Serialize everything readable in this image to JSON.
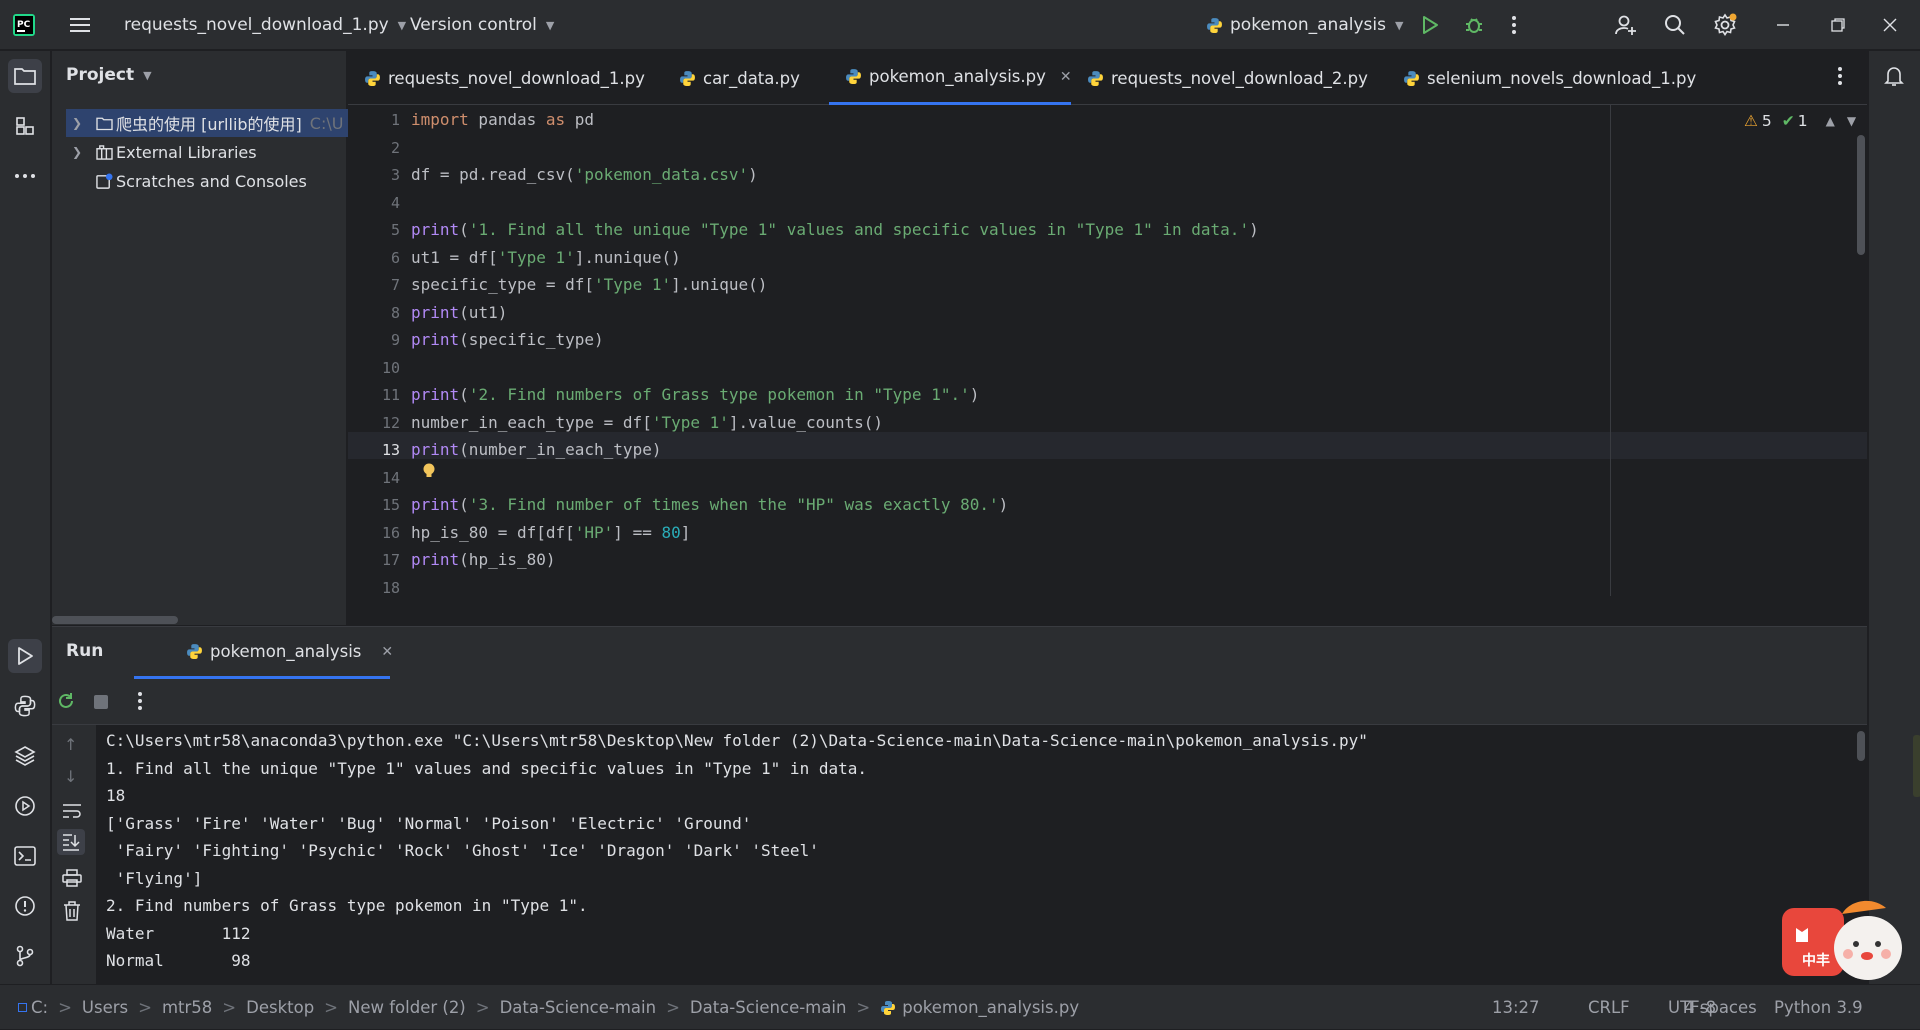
{
  "topbar": {
    "file_menu": "requests_novel_download_1.py",
    "vcs_menu": "Version control",
    "run_config": "pokemon_analysis"
  },
  "project": {
    "title": "Project",
    "items": [
      {
        "label": "爬虫的使用 [urllib的使用]",
        "path": "C:\\U"
      },
      {
        "label": "External Libraries"
      },
      {
        "label": "Scratches and Consoles"
      }
    ]
  },
  "tabs": [
    {
      "label": "requests_novel_download_1.py"
    },
    {
      "label": "car_data.py"
    },
    {
      "label": "pokemon_analysis.py",
      "active": true
    },
    {
      "label": "requests_novel_download_2.py"
    },
    {
      "label": "selenium_novels_download_1.py"
    }
  ],
  "inspections": {
    "warnings": "5",
    "ok": "1"
  },
  "code_lines": [
    [
      {
        "t": "import",
        "c": "kw"
      },
      {
        "t": " pandas "
      },
      {
        "t": "as",
        "c": "kw"
      },
      {
        "t": " pd"
      }
    ],
    [],
    [
      {
        "t": "df = pd.read_csv("
      },
      {
        "t": "'pokemon_data.csv'",
        "c": "st"
      },
      {
        "t": ")"
      }
    ],
    [],
    [
      {
        "t": "print",
        "c": "fn"
      },
      {
        "t": "("
      },
      {
        "t": "'1. Find all the unique \"Type 1\" values and specific values in \"Type 1\" in data.'",
        "c": "st"
      },
      {
        "t": ")"
      }
    ],
    [
      {
        "t": "ut1 = df["
      },
      {
        "t": "'Type 1'",
        "c": "st"
      },
      {
        "t": "].nunique()"
      }
    ],
    [
      {
        "t": "specific_type = df["
      },
      {
        "t": "'Type 1'",
        "c": "st"
      },
      {
        "t": "].unique()"
      }
    ],
    [
      {
        "t": "print",
        "c": "fn"
      },
      {
        "t": "(ut1)"
      }
    ],
    [
      {
        "t": "print",
        "c": "fn"
      },
      {
        "t": "(specific_type)"
      }
    ],
    [],
    [
      {
        "t": "print",
        "c": "fn"
      },
      {
        "t": "("
      },
      {
        "t": "'2. Find numbers of Grass type pokemon in \"Type 1\".'",
        "c": "st"
      },
      {
        "t": ")"
      }
    ],
    [
      {
        "t": "number_in_each_type = df["
      },
      {
        "t": "'Type 1'",
        "c": "st"
      },
      {
        "t": "].value_counts()"
      }
    ],
    [
      {
        "t": "print",
        "c": "fn"
      },
      {
        "t": "(number_in_each_type)"
      }
    ],
    [],
    [
      {
        "t": "print",
        "c": "fn"
      },
      {
        "t": "("
      },
      {
        "t": "'3. Find number of times when the \"HP\" was exactly 80.'",
        "c": "st"
      },
      {
        "t": ")"
      }
    ],
    [
      {
        "t": "hp_is_80 = df[df["
      },
      {
        "t": "'HP'",
        "c": "st"
      },
      {
        "t": "] == "
      },
      {
        "t": "80",
        "c": "nm"
      },
      {
        "t": "]"
      }
    ],
    [
      {
        "t": "print",
        "c": "fn"
      },
      {
        "t": "(hp_is_80)"
      }
    ],
    []
  ],
  "run": {
    "title": "Run",
    "tab": "pokemon_analysis",
    "output": [
      "C:\\Users\\mtr58\\anaconda3\\python.exe \"C:\\Users\\mtr58\\Desktop\\New folder (2)\\Data-Science-main\\Data-Science-main\\pokemon_analysis.py\"",
      "1. Find all the unique \"Type 1\" values and specific values in \"Type 1\" in data.",
      "18",
      "['Grass' 'Fire' 'Water' 'Bug' 'Normal' 'Poison' 'Electric' 'Ground'",
      " 'Fairy' 'Fighting' 'Psychic' 'Rock' 'Ghost' 'Ice' 'Dragon' 'Dark' 'Steel'",
      " 'Flying']",
      "2. Find numbers of Grass type pokemon in \"Type 1\".",
      "Water       112",
      "Normal       98"
    ]
  },
  "status": {
    "breadcrumb": [
      "C:",
      "Users",
      "mtr58",
      "Desktop",
      "New folder (2)",
      "Data-Science-main",
      "Data-Science-main",
      "pokemon_analysis.py"
    ],
    "position": "13:27",
    "line_sep": "CRLF",
    "encoding": "UTF-8",
    "indent": "4 spaces",
    "interpreter": "Python 3.9"
  },
  "badge": {
    "text": "中丰"
  },
  "colors": {
    "accent": "#3574f0",
    "run_green": "#5fb865",
    "string": "#6aab73",
    "keyword": "#cf8e6d",
    "function": "#b189f5",
    "number": "#2aacb8"
  }
}
